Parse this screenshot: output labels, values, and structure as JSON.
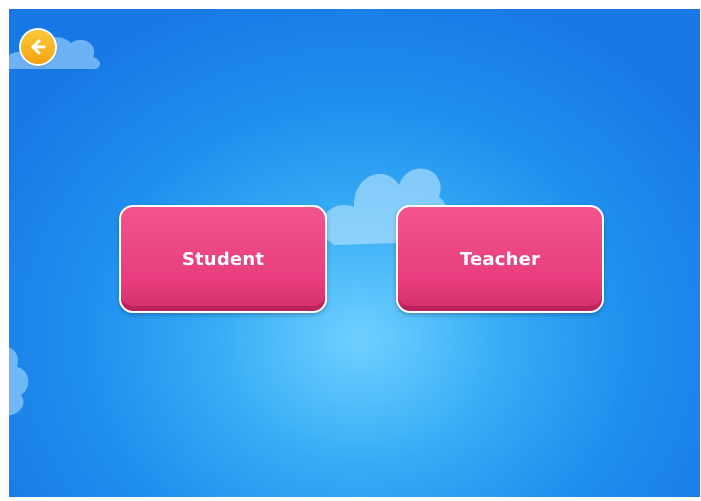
{
  "header": {
    "back_icon": "arrow-left-icon"
  },
  "role_select": {
    "student_label": "Student",
    "teacher_label": "Teacher"
  },
  "colors": {
    "background": "#1f8fee",
    "button": "#e83d7e",
    "back_button": "#f5a30e"
  }
}
